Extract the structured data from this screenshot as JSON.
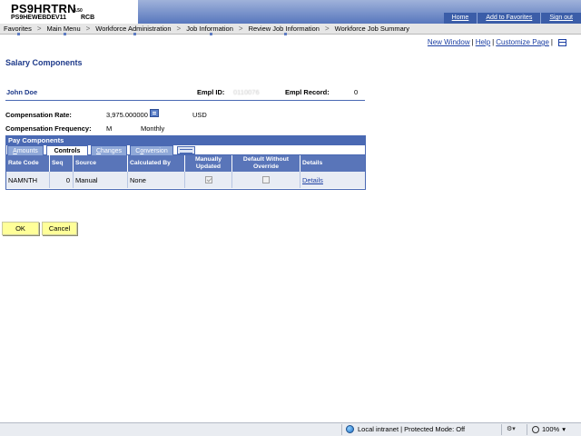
{
  "header": {
    "system_name": "PS9HRTRN",
    "version": "8.50",
    "database": "PS9HEWEBDEV11",
    "database_suffix": "RCB",
    "links": [
      "Home",
      "Add to Favorites",
      "Sign out"
    ]
  },
  "menu": {
    "items": [
      "Favorites",
      "Main Menu",
      "Workforce Administration",
      "Job Information",
      "Review Job Information",
      "Workforce Job Summary"
    ],
    "separator": ">"
  },
  "page_links": {
    "new_window": "New Window",
    "help": "Help",
    "customize_page": "Customize Page"
  },
  "page_title": "Salary Components",
  "employee": {
    "name": "John Doe",
    "empl_id_label": "Empl ID:",
    "empl_id_value": "0110076",
    "empl_record_label": "Empl Record:",
    "empl_record_value": "0"
  },
  "compensation": {
    "rate_label": "Compensation Rate:",
    "rate_value": "3,975.000000",
    "currency": "USD",
    "frequency_label": "Compensation Frequency:",
    "frequency_code": "M",
    "frequency_desc": "Monthly"
  },
  "grid": {
    "title": "Pay Components",
    "tabs": [
      {
        "prefix": "",
        "underlined": "A",
        "rest": "mounts",
        "active": false
      },
      {
        "prefix": "",
        "underlined": "",
        "rest": "Controls",
        "active": true
      },
      {
        "prefix": "",
        "underlined": "C",
        "rest": "hanges",
        "active": false
      },
      {
        "prefix": "C",
        "underlined": "o",
        "rest": "nversion",
        "active": false
      }
    ],
    "columns": [
      "Rate Code",
      "Seq",
      "Source",
      "Calculated By",
      "Manually Updated",
      "Default Without Override",
      "Details"
    ],
    "rows": [
      {
        "rate_code": "NAMNTH",
        "seq": "0",
        "source": "Manual",
        "calculated_by": "None",
        "manually_updated": true,
        "default_without_override": false,
        "details": "Details"
      }
    ]
  },
  "buttons": {
    "ok": "OK",
    "cancel": "Cancel"
  },
  "statusbar": {
    "zone": "Local intranet | Protected Mode: Off",
    "zoom": "100%"
  }
}
